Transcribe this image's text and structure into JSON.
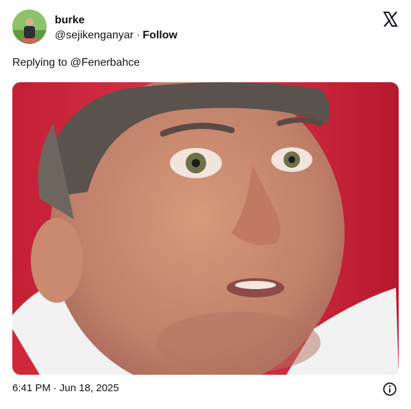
{
  "tweet": {
    "display_name": "burke",
    "handle": "@sejikenganyar",
    "separator": "·",
    "follow_label": "Follow",
    "reply_prefix": "Replying to",
    "reply_mention": "@Fenerbahce",
    "time": "6:41 PM",
    "date": "Jun 18, 2025"
  },
  "icons": {
    "logo": "x-logo-icon",
    "info": "info-icon"
  },
  "colors": {
    "text": "#0f1419",
    "media_background": "#c8283a"
  }
}
